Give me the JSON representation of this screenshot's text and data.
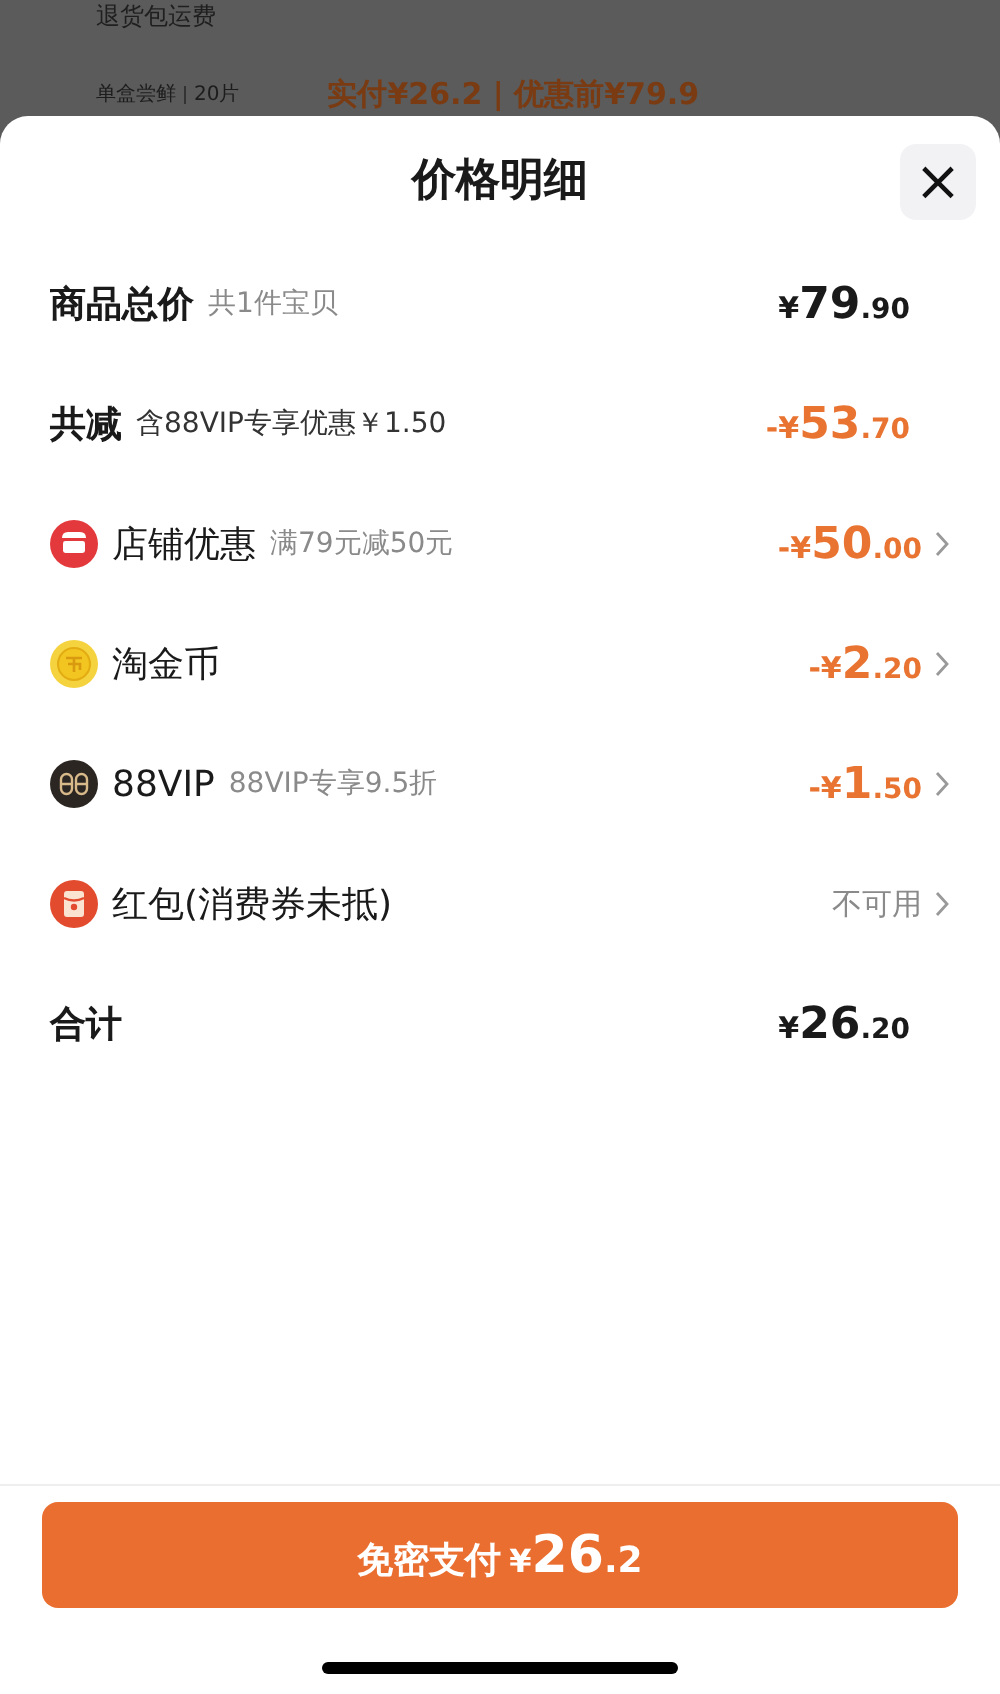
{
  "background_page": {
    "shipping_note": "退货包运费",
    "variant": "单盒尝鲜",
    "quantity": "20片",
    "price_summary": "实付¥26.2 | 优惠前¥79.9"
  },
  "sheet": {
    "title": "价格明细",
    "close": "×"
  },
  "rows": [
    {
      "kind": "subtotal",
      "label": "商品总价",
      "note": "共1件宝贝",
      "amount": {
        "lead": "¥",
        "whole": "79",
        "cents": ".90"
      },
      "negative": false,
      "link": false
    },
    {
      "kind": "discount_total",
      "label": "共减",
      "note": "含88VIP专享优惠￥1.50",
      "amount": {
        "lead": "-¥",
        "whole": "53",
        "cents": ".70"
      },
      "negative": true,
      "link": false
    },
    {
      "kind": "shop",
      "label": "店铺优惠",
      "note": "满79元减50元",
      "amount": {
        "lead": "-¥",
        "whole": "50",
        "cents": ".00"
      },
      "negative": true,
      "link": true
    },
    {
      "kind": "coin",
      "label": "淘金币",
      "amount": {
        "lead": "-¥",
        "whole": "2",
        "cents": ".20"
      },
      "negative": true,
      "link": true
    },
    {
      "kind": "vip",
      "label": "88VIP",
      "note": "88VIP专享9.5折",
      "amount": {
        "lead": "-¥",
        "whole": "1",
        "cents": ".50"
      },
      "negative": true,
      "link": true
    },
    {
      "kind": "packet",
      "label": "红包(消费券未抵)",
      "status": "不可用",
      "link": true
    },
    {
      "kind": "total",
      "label": "合计",
      "amount": {
        "lead": "¥",
        "whole": "26",
        "cents": ".20"
      },
      "negative": false,
      "link": false
    }
  ],
  "pay_button": {
    "label": "免密支付",
    "amount": {
      "lead": "¥",
      "whole": "26",
      "cents": ".2"
    }
  }
}
